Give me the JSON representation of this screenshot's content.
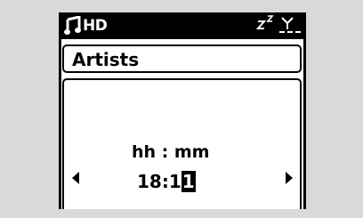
{
  "status_bar": {
    "source": "HD",
    "icons": {
      "music": "music-note-icon",
      "sleep": "sleep-zz-icon",
      "signal": "antenna-signal-icon"
    }
  },
  "title_bar": {
    "title": "Artists"
  },
  "time_setting": {
    "format_label": "hh : mm",
    "value_prefix": "18:1",
    "cursor_digit": "1"
  },
  "navigation": {
    "left_icon": "left-arrow-icon",
    "right_icon": "right-arrow-icon"
  },
  "colors": {
    "background": "#d9d9d9",
    "screen": "#ffffff",
    "ink": "#000000"
  }
}
